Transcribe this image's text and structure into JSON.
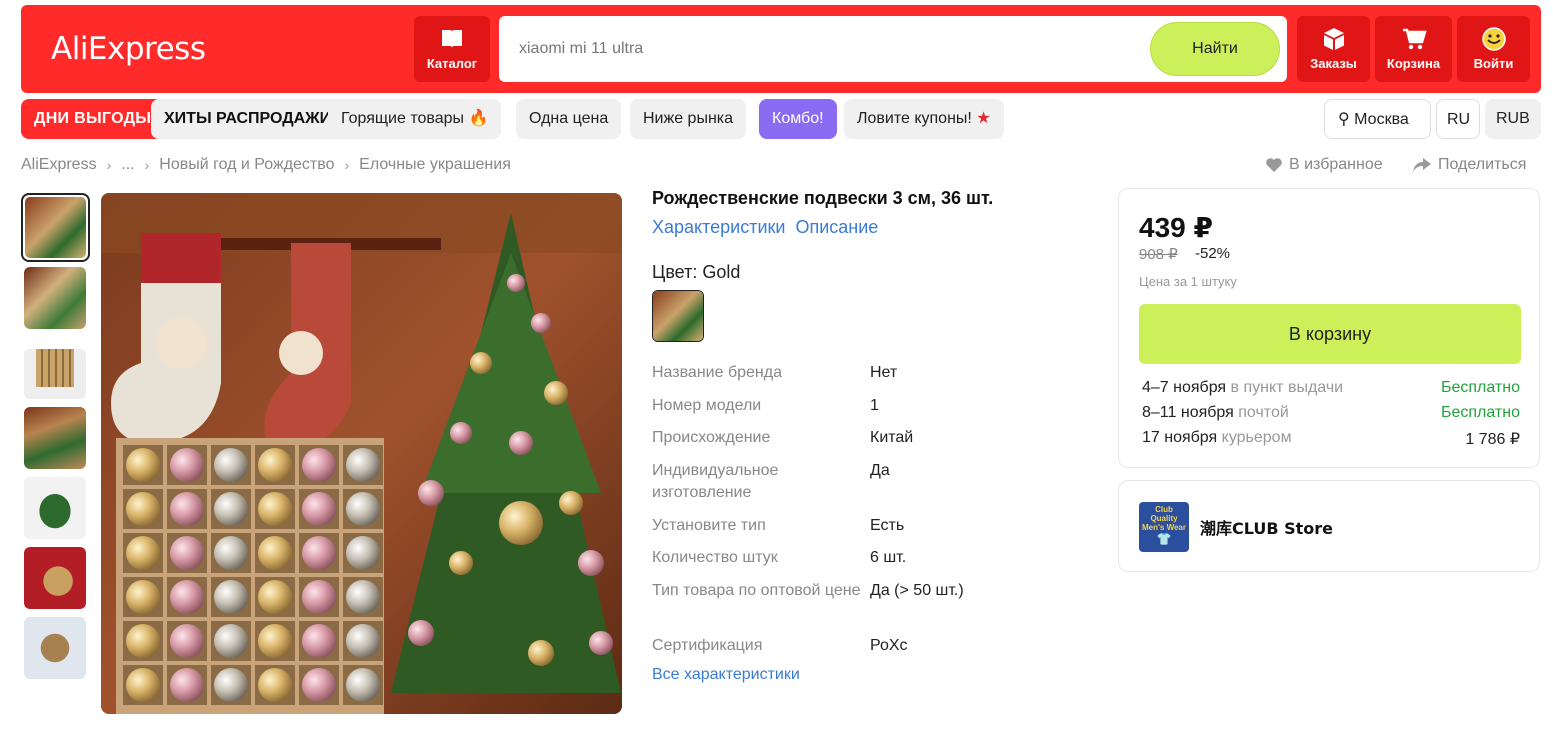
{
  "header": {
    "logo": "AliExpress",
    "catalog": "Каталог",
    "search_placeholder": "xiaomi mi 11 ultra",
    "search_button": "Найти",
    "orders": "Заказы",
    "cart": "Корзина",
    "login": "Войти",
    "brand_color": "#ff2a2a"
  },
  "nav": {
    "chips": [
      "ДНИ ВЫГОДЫ",
      "ХИТЫ РАСПРОДАЖИ",
      "Горящие товары",
      "Одна цена",
      "Ниже рынка",
      "Комбо!",
      "Ловите купоны!"
    ],
    "city": "Москва",
    "lang": "RU",
    "currency": "RUB"
  },
  "breadcrumb": [
    "AliExpress",
    "...",
    "Новый год и Рождество",
    "Елочные украшения"
  ],
  "actions": {
    "favorite": "В избранное",
    "share": "Поделиться"
  },
  "product": {
    "title": "Рождественские подвески 3 см, 36 шт.",
    "tabs": [
      "Характеристики",
      "Описание"
    ],
    "color_label": "Цвет: Gold",
    "specs": [
      {
        "k": "Название бренда",
        "v": "Нет"
      },
      {
        "k": "Номер модели",
        "v": "1"
      },
      {
        "k": "Происхождение",
        "v": "Китай"
      },
      {
        "k": "Индивидуальное изготовление",
        "v": "Да"
      },
      {
        "k": "Установите тип",
        "v": "Есть"
      },
      {
        "k": "Количество штук",
        "v": "6 шт."
      },
      {
        "k": "Тип товара по оптовой цене",
        "v": "Да (> 50 шт.)"
      },
      {
        "k": "Сертификация",
        "v": "РоХс"
      }
    ],
    "all_specs": "Все характеристики"
  },
  "buy": {
    "price": "439 ₽",
    "old_price": "908 ₽",
    "discount": "-52%",
    "unit_note": "Цена за 1 штуку",
    "cart_button": "В корзину",
    "delivery": [
      {
        "date": "4–7 ноября",
        "method": "в пункт выдачи",
        "cost": "Бесплатно",
        "free": true
      },
      {
        "date": "8–11 ноября",
        "method": "почтой",
        "cost": "Бесплатно",
        "free": true
      },
      {
        "date": "17 ноября",
        "method": "курьером",
        "cost": "1 786 ₽",
        "free": false
      }
    ]
  },
  "store": {
    "name": "潮库CLUB Store",
    "logo_text": "Club Quality Men's Wear"
  }
}
